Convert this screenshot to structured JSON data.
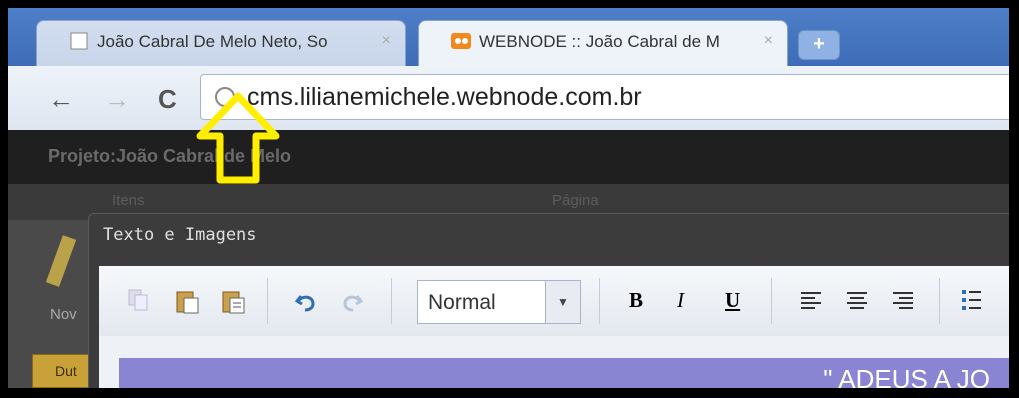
{
  "browser": {
    "tabs": [
      {
        "title": "João Cabral De Melo Neto, So",
        "close": "×"
      },
      {
        "title": "WEBNODE :: João Cabral de M",
        "close": "×"
      }
    ],
    "new_tab": "+",
    "back": "←",
    "forward": "→",
    "reload": "C",
    "address": "cms.lilianemichele.webnode.com.br"
  },
  "cms": {
    "project": "Projeto:João Cabral de Melo",
    "columns": {
      "items": "Itens",
      "page": "Página"
    },
    "left": {
      "new_label": "Nov",
      "button_label": "Dut"
    }
  },
  "dialog": {
    "title": "Texto e Imagens",
    "toolbar": {
      "format_value": "Normal",
      "bold": "B",
      "italic": "I",
      "underline": "U"
    },
    "content_preview": "\" ADEUS A JO"
  },
  "colors": {
    "arrow": "#ffee00",
    "content_bg": "#8a85d3",
    "tab_strip": "#4f7fc8"
  }
}
